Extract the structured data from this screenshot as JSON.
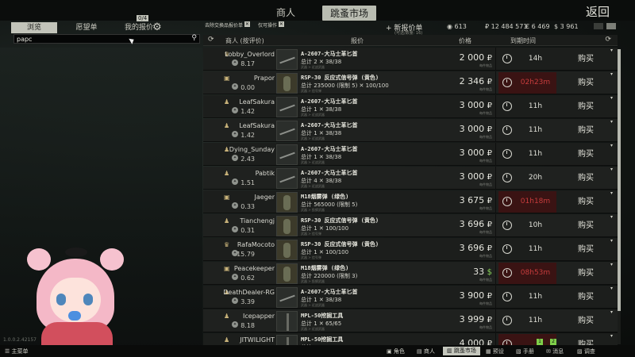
{
  "top": {
    "tabs": [
      "商人",
      "跳蚤市场"
    ],
    "active_tab": "跳蚤市场",
    "back_label": "返回"
  },
  "left_panel": {
    "tabs": [
      "浏览",
      "愿望单",
      "我的报价"
    ],
    "offer_count": "0/4",
    "search_value": "papc",
    "version": "1.0.0.2.42157"
  },
  "filters": {
    "remove_bartered": "去除交换品报价单",
    "only_operation": "仅可操作",
    "add_offer": "+ 新报价单",
    "add_offer_sub": "(可选/数量: 16)"
  },
  "currencies": {
    "gp": "613",
    "rub": "₽ 12 484 571",
    "eur": "€ 6 469",
    "usd": "$ 3 961"
  },
  "table": {
    "headers": {
      "seller": "商人 (按评价)",
      "offer": "报价",
      "price": "价格",
      "expires": "到期时间"
    },
    "buy_label": "购买",
    "price_sub": "每件物品",
    "rows": [
      {
        "seller": "Lobby_Overlord",
        "seller_icon": "crown-icon",
        "rep": "8.17",
        "thumb": "knife",
        "item": "A-2607-大马士革匕首",
        "qty": "总计 2  ✕ 38/38",
        "note": "武器 > 近战武器",
        "price": "2 000",
        "cur": "₽",
        "time": "14h",
        "urgent": false
      },
      {
        "seller": "Prapor",
        "seller_icon": "trader-icon",
        "rep": "0.00",
        "thumb": "gren",
        "item": "RSP-30 反应式信号弹 (黄色)",
        "qty": "总计 235000 (限制 5)  ✕ 100/100",
        "note": "武器 > 信号弹",
        "price": "2 346",
        "cur": "₽",
        "time": "02h23m",
        "urgent": true
      },
      {
        "seller": "LeafSakura",
        "seller_icon": "user-icon",
        "rep": "1.42",
        "thumb": "knife",
        "item": "A-2607-大马士革匕首",
        "qty": "总计 1  ✕ 38/38",
        "note": "武器 > 近战武器",
        "price": "3 000",
        "cur": "₽",
        "time": "11h",
        "urgent": false
      },
      {
        "seller": "LeafSakura",
        "seller_icon": "user-icon",
        "rep": "1.42",
        "thumb": "knife",
        "item": "A-2607-大马士革匕首",
        "qty": "总计 1  ✕ 38/38",
        "note": "武器 > 近战武器",
        "price": "3 000",
        "cur": "₽",
        "time": "11h",
        "urgent": false
      },
      {
        "seller": "Dying_Sunday",
        "seller_icon": "user-icon",
        "rep": "2.43",
        "thumb": "knife",
        "item": "A-2607-大马士革匕首",
        "qty": "总计 1  ✕ 38/38",
        "note": "武器 > 近战武器",
        "price": "3 000",
        "cur": "₽",
        "time": "11h",
        "urgent": false
      },
      {
        "seller": "Pabtik",
        "seller_icon": "user-icon",
        "rep": "1.51",
        "thumb": "knife",
        "item": "A-2607-大马士革匕首",
        "qty": "总计 4  ✕ 38/38",
        "note": "武器 > 近战武器",
        "price": "3 000",
        "cur": "₽",
        "time": "20h",
        "urgent": false
      },
      {
        "seller": "Jaeger",
        "seller_icon": "trader-icon",
        "rep": "0.33",
        "thumb": "gren",
        "item": "M18烟雾弹 (绿色)",
        "qty": "总计 565000 (限制 5)",
        "note": "武器 > 投掷武器",
        "price": "3 675",
        "cur": "₽",
        "time": "01h18m",
        "urgent": true
      },
      {
        "seller": "Tianchengj",
        "seller_icon": "user-icon",
        "rep": "0.31",
        "thumb": "gren",
        "item": "RSP-30 反应式信号弹 (黄色)",
        "qty": "总计 1  ✕ 100/100",
        "note": "武器 > 信号弹",
        "price": "3 696",
        "cur": "₽",
        "time": "10h",
        "urgent": false
      },
      {
        "seller": "RafaMocoto",
        "seller_icon": "crown-icon",
        "rep": "15.79",
        "thumb": "gren",
        "item": "RSP-30 反应式信号弹 (黄色)",
        "qty": "总计 1  ✕ 100/100",
        "note": "武器 > 信号弹",
        "price": "3 696",
        "cur": "₽",
        "time": "11h",
        "urgent": false
      },
      {
        "seller": "Peacekeeper",
        "seller_icon": "trader-icon",
        "rep": "0.62",
        "thumb": "gren",
        "item": "M18烟雾弹 (绿色)",
        "qty": "总计 220000 (限制 3)",
        "note": "武器 > 投掷武器",
        "price": "33",
        "cur": "$",
        "time": "08h53m",
        "urgent": true
      },
      {
        "seller": "DeathDealer-RG",
        "seller_icon": "user-icon",
        "rep": "3.39",
        "thumb": "knife",
        "item": "A-2607-大马士革匕首",
        "qty": "总计 1  ✕ 38/38",
        "note": "武器 > 近战武器",
        "price": "3 900",
        "cur": "₽",
        "time": "11h",
        "urgent": false
      },
      {
        "seller": "Icepapper",
        "seller_icon": "user-icon",
        "rep": "8.18",
        "thumb": "shovel",
        "item": "MPL-50挖掘工具",
        "qty": "总计 1  ✕ 65/65",
        "note": "武器 > 近战武器",
        "price": "3 999",
        "cur": "₽",
        "time": "11h",
        "urgent": false
      },
      {
        "seller": "JITWILIGHT",
        "seller_icon": "user-icon",
        "rep": "",
        "thumb": "shovel",
        "item": "MPL-50挖掘工具",
        "qty": "总计 1  ✕ 65/65",
        "note": "",
        "price": "4 000",
        "cur": "₽",
        "time": "",
        "urgent": true
      }
    ]
  },
  "bottom": {
    "main_menu": "主菜单",
    "items": [
      "角色",
      "商人",
      "跳蚤市场",
      "预设",
      "手册",
      "消息",
      "调查"
    ],
    "active": "跳蚤市场",
    "badges": [
      "1",
      "2"
    ]
  }
}
